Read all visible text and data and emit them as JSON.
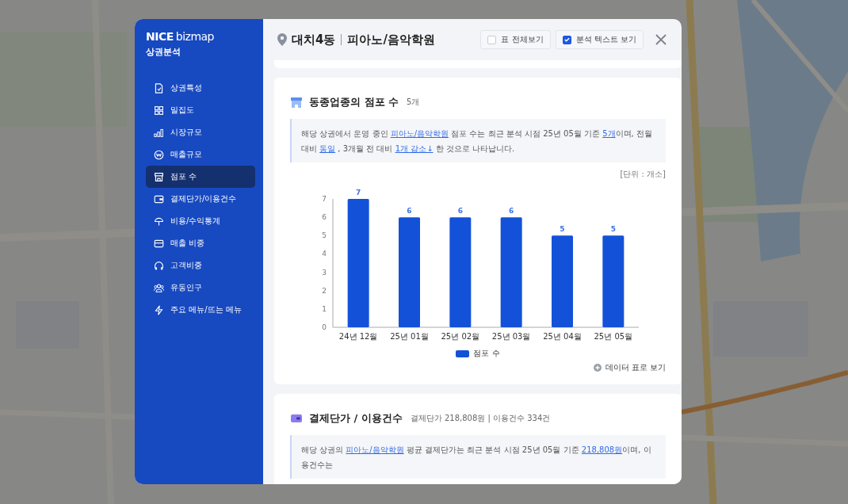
{
  "sidebar": {
    "logo": {
      "brand": "NICE",
      "product": "bizmap"
    },
    "title": "상권분석",
    "items": [
      {
        "label": "상권특성",
        "selected": false
      },
      {
        "label": "밀집도",
        "selected": false
      },
      {
        "label": "시장규모",
        "selected": false
      },
      {
        "label": "매출규모",
        "selected": false
      },
      {
        "label": "점포 수",
        "selected": true
      },
      {
        "label": "결제단가/이용건수",
        "selected": false
      },
      {
        "label": "비용/수익통계",
        "selected": false
      },
      {
        "label": "매출 비중",
        "selected": false
      },
      {
        "label": "고객비중",
        "selected": false
      },
      {
        "label": "유동인구",
        "selected": false
      },
      {
        "label": "주요 메뉴/뜨는 메뉴",
        "selected": false
      }
    ]
  },
  "header": {
    "area": "대치4동",
    "category": "피아노/음악학원",
    "toggles": [
      {
        "label": "표 전체보기",
        "checked": false
      },
      {
        "label": "분석 텍스트 보기",
        "checked": true
      }
    ]
  },
  "sections": [
    {
      "title": "동종업종의 점포 수",
      "summary": "5개",
      "text": [
        {
          "kind": "text",
          "text": "해당 상권에서 운영 중인 "
        },
        {
          "kind": "link",
          "text": "피아노/음악학원"
        },
        {
          "kind": "text",
          "text": " 점포 수는 최근 분석 시점 25년 05월 기준 "
        },
        {
          "kind": "link",
          "text": "5개"
        },
        {
          "kind": "text",
          "text": "이며, 전월 대비 "
        },
        {
          "kind": "link",
          "text": "동일"
        },
        {
          "kind": "text",
          "text": " , 3개월 전 대비 "
        },
        {
          "kind": "link",
          "text": "1개 감소↓"
        },
        {
          "kind": "text",
          "text": " 한 것으로 나타납니다."
        }
      ],
      "unit": "[단위 : 개소]",
      "chart_data": {
        "type": "bar",
        "categories": [
          "24년 12월",
          "25년 01월",
          "25년 02월",
          "25년 03월",
          "25년 04월",
          "25년 05월"
        ],
        "series": [
          {
            "name": "점포 수",
            "color": "#1352d8",
            "values": [
              7,
              6,
              6,
              6,
              5,
              5
            ]
          }
        ],
        "ylim": [
          0,
          7
        ],
        "yticks": [
          0,
          1,
          2,
          3,
          4,
          5,
          6,
          7
        ],
        "data_labels": true
      },
      "table_link": "데이터 표로 보기"
    },
    {
      "title": "결제단가 / 이용건수",
      "summary": "결제단가 218,808원 | 이용건수 334건",
      "text": [
        {
          "kind": "text",
          "text": "해당 상권의 "
        },
        {
          "kind": "link",
          "text": "피아노/음악학원"
        },
        {
          "kind": "text",
          "text": " 평균 결제단가는 최근 분석 시점 25년 05월 기준 "
        },
        {
          "kind": "link",
          "text": "218,808원"
        },
        {
          "kind": "text",
          "text": "이며, 이용건수는"
        }
      ]
    }
  ]
}
